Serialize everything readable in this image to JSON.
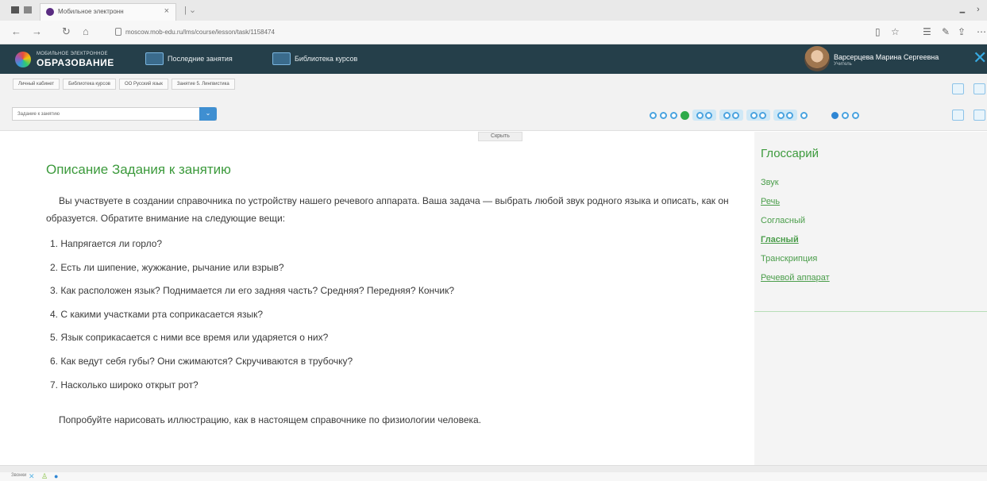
{
  "browser": {
    "tab_title": "Мобильное электронн",
    "tab_close": "×",
    "tab_plus": "|  ⌄",
    "url": "moscow.mob-edu.ru/lms/course/lesson/task/1158474",
    "win_min": "🗕",
    "win_more": "›"
  },
  "header": {
    "logo_top": "МОБИЛЬНОЕ ЭЛЕКТРОННОЕ",
    "logo_main": "ОБРАЗОВАНИЕ",
    "link_recent": "Последние занятия",
    "link_library": "Библиотека курсов",
    "user_name": "Варсерцева Марина Сергеевна",
    "user_role": "Учитель",
    "close": "✕"
  },
  "breadcrumbs": [
    "Личный кабинет",
    "Библиотека курсов",
    "ОО Русский язык",
    "Занятие 5. Лингвистика"
  ],
  "selector": {
    "value": "Задание к занятию",
    "arrow": "⌄"
  },
  "hide_label": "Скрыть",
  "content": {
    "title": "Описание Задания к занятию",
    "intro": "Вы участвуете в создании справочника по устройству нашего речевого аппарата. Ваша задача — выбрать любой звук родного языка и описать, как он образуется. Обратите внимание на следующие вещи:",
    "questions": [
      "1. Напрягается ли горло?",
      "2. Есть ли шипение, жужжание, рычание или взрыв?",
      "3. Как расположен язык? Поднимается ли его задняя часть? Средняя? Передняя? Кончик?",
      "4. С какими участками рта соприкасается язык?",
      "5. Язык соприкасается с ними все время или ударяется о них?",
      "6. Как ведут себя губы? Они сжимаются? Скручиваются в трубочку?",
      "7. Насколько широко открыт рот?"
    ],
    "outro": "Попробуйте нарисовать иллюстрацию, как в настоящем справочнике по физиологии человека."
  },
  "glossary": {
    "title": "Глоссарий",
    "items": [
      "Звук",
      "Речь",
      "Согласный",
      "Гласный",
      "Транскрипция",
      "Речевой аппарат"
    ]
  },
  "status": {
    "text": "Звонки"
  },
  "colors": {
    "header_bg": "#253f4a",
    "accent_green": "#3c9a3c",
    "accent_blue": "#3f8fd1"
  }
}
